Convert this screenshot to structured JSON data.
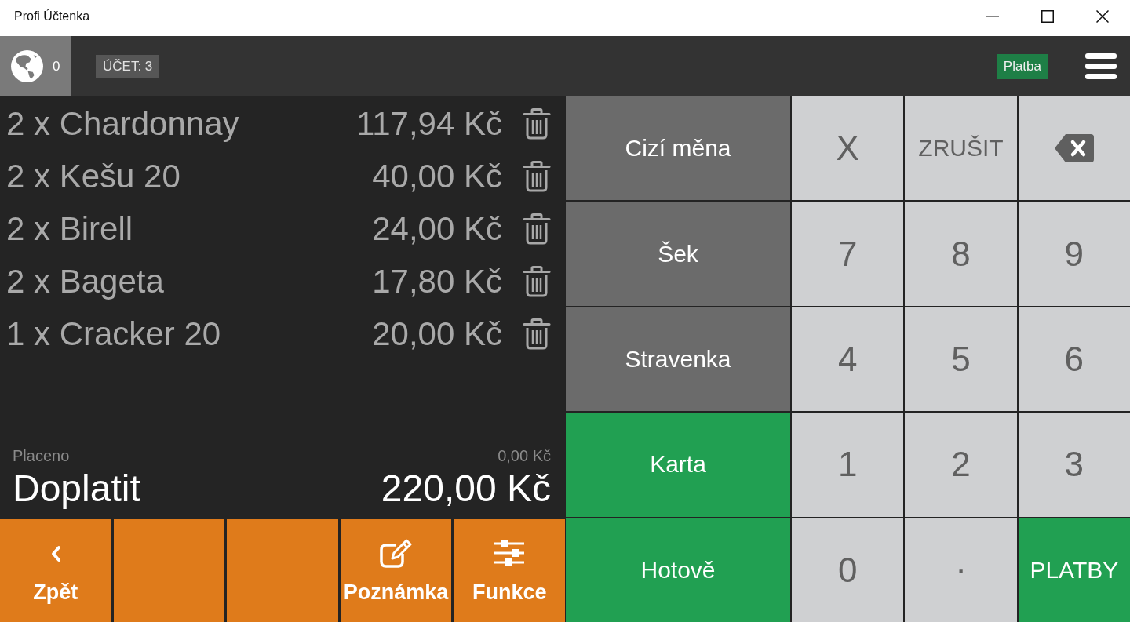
{
  "window": {
    "title": "Profi Účtenka"
  },
  "toolbar": {
    "globe_count": "0",
    "account": "ÚČET: 3",
    "mode": "Platba"
  },
  "items": [
    {
      "label": "2 x Chardonnay",
      "price": "117,94 Kč"
    },
    {
      "label": "2 x Kešu 20",
      "price": "40,00 Kč"
    },
    {
      "label": "2 x Birell",
      "price": "24,00 Kč"
    },
    {
      "label": "2 x Bageta",
      "price": "17,80 Kč"
    },
    {
      "label": "1 x Cracker 20",
      "price": "20,00 Kč"
    }
  ],
  "summary": {
    "paid_label": "Placeno",
    "paid_amount": "0,00 Kč",
    "due_label": "Doplatit",
    "due_amount": "220,00 Kč"
  },
  "actions": [
    {
      "kind": "back",
      "label": "Zpět"
    },
    {
      "kind": "blank"
    },
    {
      "kind": "blank"
    },
    {
      "kind": "note",
      "label": "Poznámka"
    },
    {
      "kind": "functions",
      "label": "Funkce"
    }
  ],
  "payment_methods": [
    {
      "label": "Cizí měna",
      "color": "#6b6b6b"
    },
    {
      "label": "Šek",
      "color": "#6b6b6b"
    },
    {
      "label": "Stravenka",
      "color": "#6b6b6b"
    },
    {
      "label": "Karta",
      "color": "#21a052"
    },
    {
      "label": "Hotově",
      "color": "#21a052"
    }
  ],
  "keypad": [
    {
      "kind": "digit",
      "label": "X"
    },
    {
      "kind": "text",
      "label": "ZRUŠIT"
    },
    {
      "kind": "backspace"
    },
    {
      "kind": "digit",
      "label": "7"
    },
    {
      "kind": "digit",
      "label": "8"
    },
    {
      "kind": "digit",
      "label": "9"
    },
    {
      "kind": "digit",
      "label": "4"
    },
    {
      "kind": "digit",
      "label": "5"
    },
    {
      "kind": "digit",
      "label": "6"
    },
    {
      "kind": "digit",
      "label": "1"
    },
    {
      "kind": "digit",
      "label": "2"
    },
    {
      "kind": "digit",
      "label": "3"
    },
    {
      "kind": "digit",
      "label": "0"
    },
    {
      "kind": "decimal",
      "label": "."
    },
    {
      "kind": "confirm",
      "label": "PLATBY"
    }
  ]
}
